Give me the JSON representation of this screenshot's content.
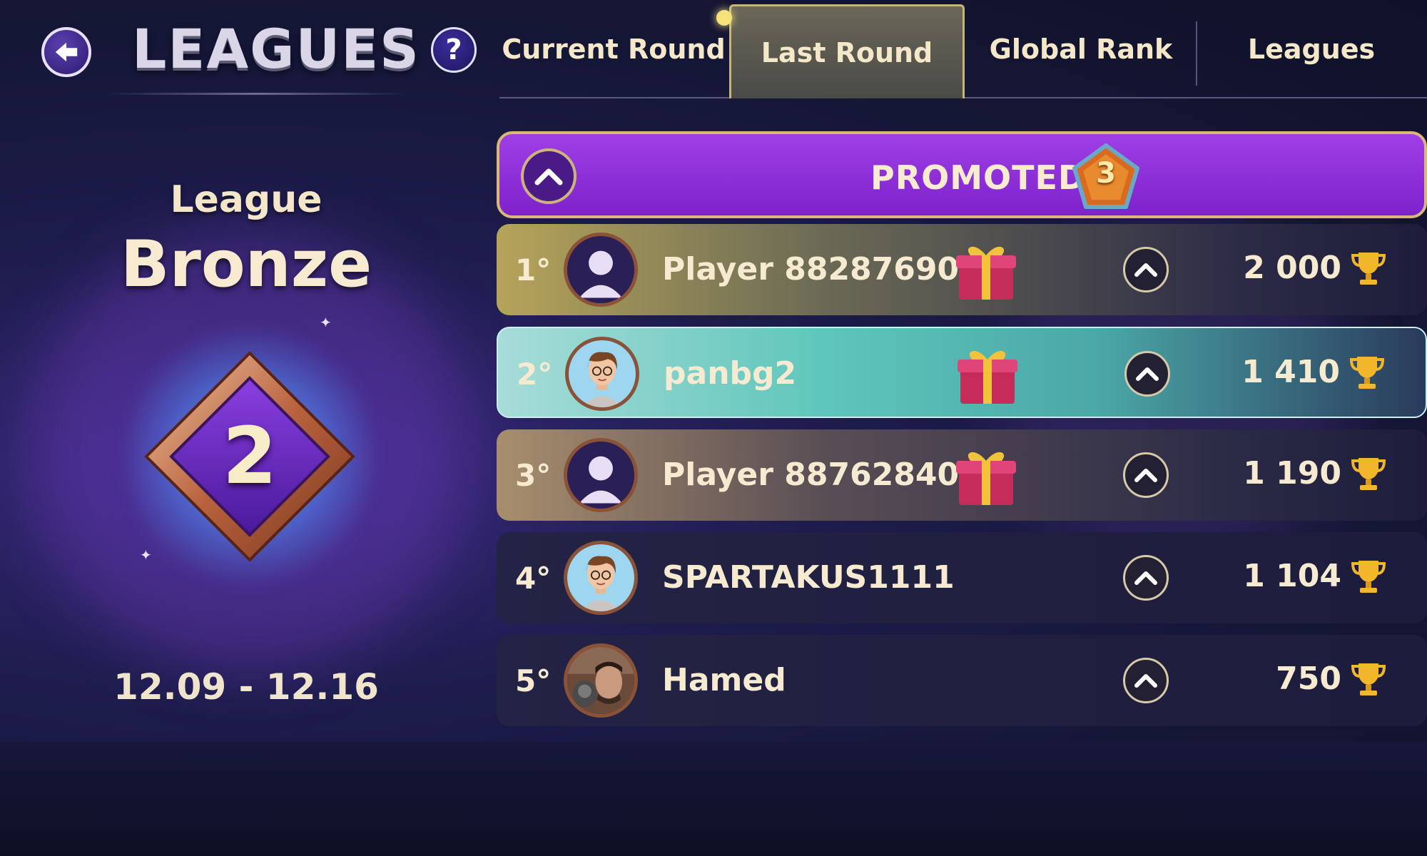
{
  "header": {
    "title": "LEAGUES",
    "help_label": "?"
  },
  "tabs": [
    {
      "label": "Current Round",
      "active": false
    },
    {
      "label": "Last Round",
      "active": true
    },
    {
      "label": "Global Rank",
      "active": false
    },
    {
      "label": "Leagues",
      "active": false
    }
  ],
  "league": {
    "label": "League",
    "name": "Bronze",
    "level": "2",
    "dates": "12.09 - 12.16"
  },
  "promoted": {
    "label": "PROMOTED",
    "count": "3"
  },
  "players": [
    {
      "rank": "1°",
      "name": "Player 88287690",
      "score": "2 000",
      "avatar": "default-avatar-icon",
      "gift": true
    },
    {
      "rank": "2°",
      "name": "panbg2",
      "score": "1 410",
      "avatar": "cartoon-boy-avatar",
      "gift": true
    },
    {
      "rank": "3°",
      "name": "Player 88762840",
      "score": "1 190",
      "avatar": "default-avatar-icon",
      "gift": true
    },
    {
      "rank": "4°",
      "name": "SPARTAKUS1111",
      "score": "1 104",
      "avatar": "cartoon-boy-avatar",
      "gift": false
    },
    {
      "rank": "5°",
      "name": "Hamed",
      "score": "750",
      "avatar": "photo-avatar",
      "gift": false
    }
  ],
  "colors": {
    "background": "#1d1c4c",
    "promoted_banner": "#8f33db",
    "gold_border": "#d9b87a",
    "text_cream": "#f6ead0",
    "row_highlight": "#5fc6bb"
  }
}
